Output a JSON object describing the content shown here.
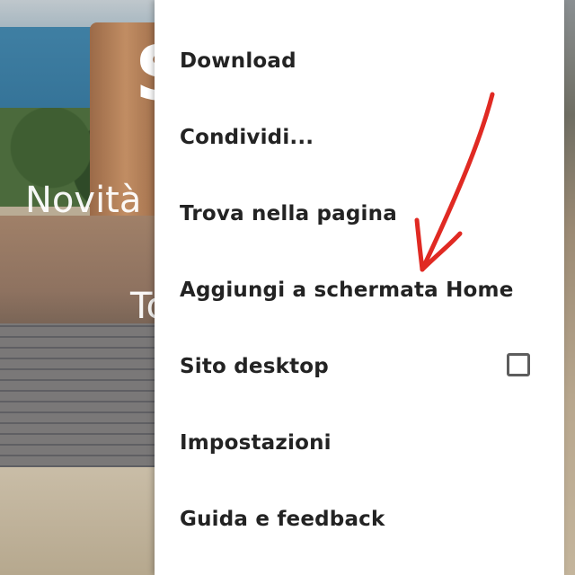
{
  "background": {
    "big_letter": "S",
    "line1": "Novità p",
    "line2": "To"
  },
  "menu": {
    "items": [
      {
        "label": "Download"
      },
      {
        "label": "Condividi..."
      },
      {
        "label": "Trova nella pagina"
      },
      {
        "label": "Aggiungi a schermata Home"
      },
      {
        "label": "Sito desktop",
        "checkbox": false
      },
      {
        "label": "Impostazioni"
      },
      {
        "label": "Guida e feedback"
      }
    ]
  },
  "annotation": {
    "arrow_icon": "red-hand-drawn-arrow-icon",
    "arrow_color": "#e02a23"
  }
}
